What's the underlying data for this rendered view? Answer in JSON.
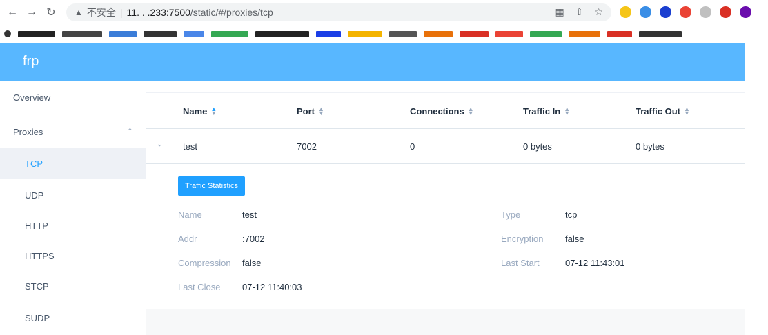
{
  "browser": {
    "security_label": "不安全",
    "url_host": "11.  . .233:7500",
    "url_path": "/static/#/proxies/tcp",
    "ext_colors": [
      "#f5c518",
      "#3a8ee6",
      "#1b3fd0",
      "#ea4335",
      "#c0c0c0",
      "#d93025",
      "#6a0dad"
    ]
  },
  "app": {
    "logo": "frp",
    "accent_color": "#58b7ff",
    "active_color": "#20a0ff"
  },
  "sidebar": {
    "overview": "Overview",
    "proxies": "Proxies",
    "items": [
      {
        "label": "TCP"
      },
      {
        "label": "UDP"
      },
      {
        "label": "HTTP"
      },
      {
        "label": "HTTPS"
      },
      {
        "label": "STCP"
      },
      {
        "label": "SUDP"
      }
    ]
  },
  "table": {
    "columns": [
      "Name",
      "Port",
      "Connections",
      "Traffic In",
      "Traffic Out"
    ],
    "rows": [
      {
        "name": "test",
        "port": "7002",
        "connections": "0",
        "traffic_in": "0 bytes",
        "traffic_out": "0 bytes"
      }
    ]
  },
  "details": {
    "button": "Traffic Statistics",
    "name_label": "Name",
    "name_value": "test",
    "type_label": "Type",
    "type_value": "tcp",
    "addr_label": "Addr",
    "addr_value": ":7002",
    "encryption_label": "Encryption",
    "encryption_value": "false",
    "compression_label": "Compression",
    "compression_value": "false",
    "last_start_label": "Last Start",
    "last_start_value": "07-12 11:43:01",
    "last_close_label": "Last Close",
    "last_close_value": "07-12 11:40:03"
  }
}
